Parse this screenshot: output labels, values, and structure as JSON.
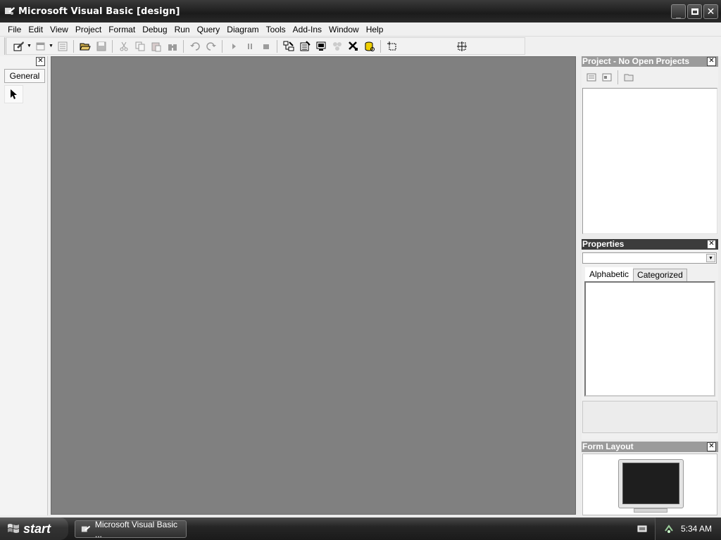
{
  "window": {
    "title": "Microsoft Visual Basic [design]"
  },
  "menu": [
    "File",
    "Edit",
    "View",
    "Project",
    "Format",
    "Debug",
    "Run",
    "Query",
    "Diagram",
    "Tools",
    "Add-Ins",
    "Window",
    "Help"
  ],
  "toolbox": {
    "tab_label": "General"
  },
  "project_panel": {
    "title": "Project - No Open Projects"
  },
  "properties_panel": {
    "title": "Properties",
    "object_value": "",
    "tabs": [
      "Alphabetic",
      "Categorized"
    ]
  },
  "form_layout_panel": {
    "title": "Form Layout"
  },
  "taskbar": {
    "start_label": "start",
    "task_label": "Microsoft Visual Basic ...",
    "clock": "5:34 AM"
  },
  "colors": {
    "mdi_background": "#808080",
    "active_panel_header": "#3c3c3c",
    "inactive_panel_header": "#9b9b9b"
  }
}
